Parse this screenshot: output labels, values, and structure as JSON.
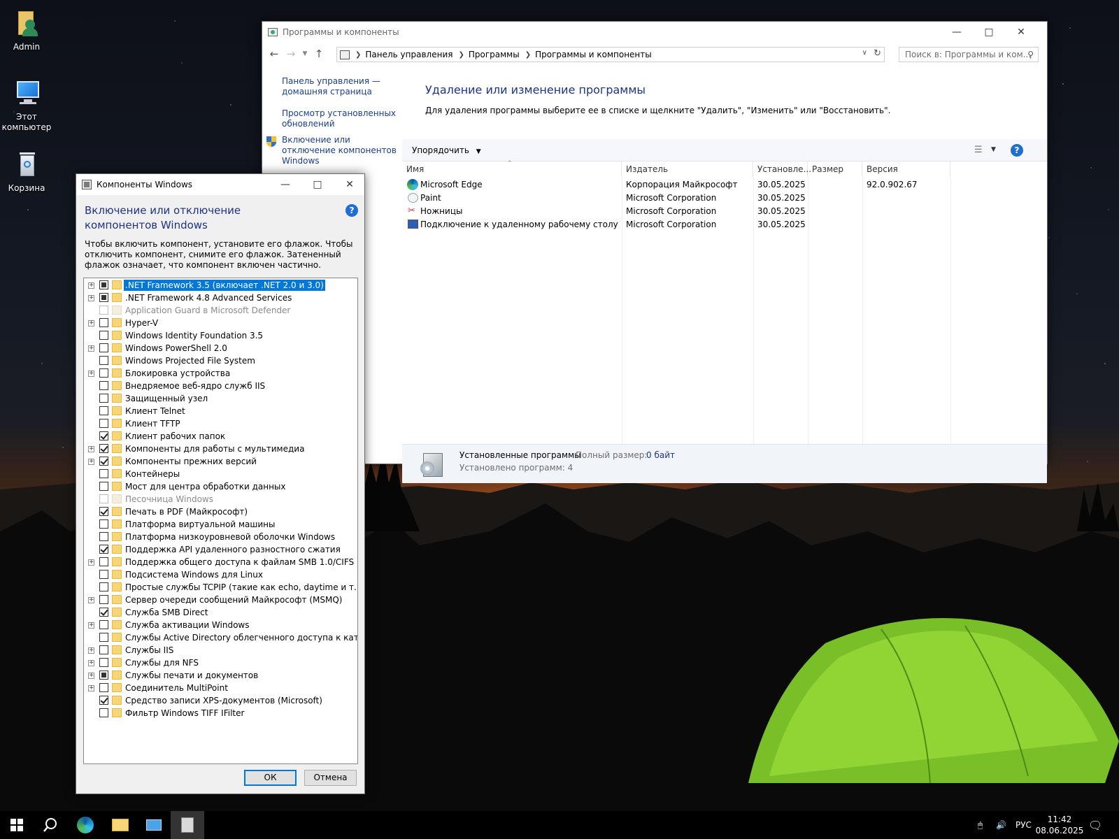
{
  "desktop": {
    "icons": [
      {
        "label": "Admin",
        "icon": "user-folder-icon"
      },
      {
        "label": "Этот компьютер",
        "icon": "computer-icon"
      },
      {
        "label": "Корзина",
        "icon": "recycle-bin-icon"
      }
    ]
  },
  "programs_window": {
    "title": "Программы и компоненты",
    "breadcrumb": [
      "Панель управления",
      "Программы",
      "Программы и компоненты"
    ],
    "search_placeholder": "Поиск в: Программы и ком...",
    "left_links": [
      "Панель управления — домашняя страница",
      "Просмотр установленных обновлений",
      "Включение или отключение компонентов Windows"
    ],
    "heading": "Удаление или изменение программы",
    "description": "Для удаления программы выберите ее в списке и щелкните \"Удалить\", \"Изменить\" или \"Восстановить\".",
    "organize_label": "Упорядочить",
    "columns": [
      "Имя",
      "Издатель",
      "Установле...",
      "Размер",
      "Версия"
    ],
    "rows": [
      {
        "name": "Microsoft Edge",
        "publisher": "Корпорация Майкрософт",
        "installed": "30.05.2025",
        "size": "",
        "version": "92.0.902.67",
        "icon": "edge-icon"
      },
      {
        "name": "Paint",
        "publisher": "Microsoft Corporation",
        "installed": "30.05.2025",
        "size": "",
        "version": "",
        "icon": "paint-icon"
      },
      {
        "name": "Ножницы",
        "publisher": "Microsoft Corporation",
        "installed": "30.05.2025",
        "size": "",
        "version": "",
        "icon": "snipping-tool-icon"
      },
      {
        "name": "Подключение к удаленному рабочему столу",
        "publisher": "Microsoft Corporation",
        "installed": "30.05.2025",
        "size": "",
        "version": "",
        "icon": "remote-desktop-icon"
      }
    ],
    "status": {
      "title": "Установленные программы",
      "total_size_label": "Полный размер:",
      "total_size_value": "0 байт",
      "count_text": "Установлено программ: 4"
    }
  },
  "components_window": {
    "title": "Компоненты Windows",
    "heading": "Включение или отключение компонентов Windows",
    "description": "Чтобы включить компонент, установите его флажок. Чтобы отключить компонент, снимите его флажок. Затененный флажок означает, что компонент включен частично.",
    "items": [
      {
        "label": ".NET Framework 3.5 (включает .NET 2.0 и 3.0)",
        "state": "partial",
        "expandable": true,
        "selected": true,
        "disabled": false
      },
      {
        "label": ".NET Framework 4.8 Advanced Services",
        "state": "partial",
        "expandable": true,
        "selected": false,
        "disabled": false
      },
      {
        "label": "Application Guard в Microsoft Defender",
        "state": "unchecked",
        "expandable": false,
        "selected": false,
        "disabled": true
      },
      {
        "label": "Hyper-V",
        "state": "unchecked",
        "expandable": true,
        "selected": false,
        "disabled": false
      },
      {
        "label": "Windows Identity Foundation 3.5",
        "state": "unchecked",
        "expandable": false,
        "selected": false,
        "disabled": false
      },
      {
        "label": "Windows PowerShell 2.0",
        "state": "unchecked",
        "expandable": true,
        "selected": false,
        "disabled": false
      },
      {
        "label": "Windows Projected File System",
        "state": "unchecked",
        "expandable": false,
        "selected": false,
        "disabled": false
      },
      {
        "label": "Блокировка устройства",
        "state": "unchecked",
        "expandable": true,
        "selected": false,
        "disabled": false
      },
      {
        "label": "Внедряемое веб-ядро служб IIS",
        "state": "unchecked",
        "expandable": false,
        "selected": false,
        "disabled": false
      },
      {
        "label": "Защищенный узел",
        "state": "unchecked",
        "expandable": false,
        "selected": false,
        "disabled": false
      },
      {
        "label": "Клиент Telnet",
        "state": "unchecked",
        "expandable": false,
        "selected": false,
        "disabled": false
      },
      {
        "label": "Клиент TFTP",
        "state": "unchecked",
        "expandable": false,
        "selected": false,
        "disabled": false
      },
      {
        "label": "Клиент рабочих папок",
        "state": "checked",
        "expandable": false,
        "selected": false,
        "disabled": false
      },
      {
        "label": "Компоненты для работы с мультимедиа",
        "state": "checked",
        "expandable": true,
        "selected": false,
        "disabled": false
      },
      {
        "label": "Компоненты прежних версий",
        "state": "checked",
        "expandable": true,
        "selected": false,
        "disabled": false
      },
      {
        "label": "Контейнеры",
        "state": "unchecked",
        "expandable": false,
        "selected": false,
        "disabled": false
      },
      {
        "label": "Мост для центра обработки данных",
        "state": "unchecked",
        "expandable": false,
        "selected": false,
        "disabled": false
      },
      {
        "label": "Песочница Windows",
        "state": "unchecked",
        "expandable": false,
        "selected": false,
        "disabled": true
      },
      {
        "label": "Печать в PDF (Майкрософт)",
        "state": "checked",
        "expandable": false,
        "selected": false,
        "disabled": false
      },
      {
        "label": "Платформа виртуальной машины",
        "state": "unchecked",
        "expandable": false,
        "selected": false,
        "disabled": false
      },
      {
        "label": "Платформа низкоуровневой оболочки Windows",
        "state": "unchecked",
        "expandable": false,
        "selected": false,
        "disabled": false
      },
      {
        "label": "Поддержка API удаленного разностного сжатия",
        "state": "checked",
        "expandable": false,
        "selected": false,
        "disabled": false
      },
      {
        "label": "Поддержка общего доступа к файлам SMB 1.0/CIFS",
        "state": "unchecked",
        "expandable": true,
        "selected": false,
        "disabled": false
      },
      {
        "label": "Подсистема Windows для Linux",
        "state": "unchecked",
        "expandable": false,
        "selected": false,
        "disabled": false
      },
      {
        "label": "Простые службы TCPIP (такие как echo, daytime и т.п.)",
        "state": "unchecked",
        "expandable": false,
        "selected": false,
        "disabled": false
      },
      {
        "label": "Сервер очереди сообщений Майкрософт (MSMQ)",
        "state": "unchecked",
        "expandable": true,
        "selected": false,
        "disabled": false
      },
      {
        "label": "Служба SMB Direct",
        "state": "checked",
        "expandable": false,
        "selected": false,
        "disabled": false
      },
      {
        "label": "Служба активации Windows",
        "state": "unchecked",
        "expandable": true,
        "selected": false,
        "disabled": false
      },
      {
        "label": "Службы Active Directory облегченного доступа к каталогам",
        "state": "unchecked",
        "expandable": false,
        "selected": false,
        "disabled": false
      },
      {
        "label": "Службы IIS",
        "state": "unchecked",
        "expandable": true,
        "selected": false,
        "disabled": false
      },
      {
        "label": "Службы для NFS",
        "state": "unchecked",
        "expandable": true,
        "selected": false,
        "disabled": false
      },
      {
        "label": "Службы печати и документов",
        "state": "partial",
        "expandable": true,
        "selected": false,
        "disabled": false
      },
      {
        "label": "Соединитель MultiPoint",
        "state": "unchecked",
        "expandable": true,
        "selected": false,
        "disabled": false
      },
      {
        "label": "Средство записи XPS-документов (Microsoft)",
        "state": "checked",
        "expandable": false,
        "selected": false,
        "disabled": false
      },
      {
        "label": "Фильтр Windows TIFF IFilter",
        "state": "unchecked",
        "expandable": false,
        "selected": false,
        "disabled": false
      }
    ],
    "ok_label": "ОК",
    "cancel_label": "Отмена"
  },
  "taskbar": {
    "language": "РУС",
    "time": "11:42",
    "date": "08.06.2025"
  },
  "colors": {
    "accent": "#0078d7",
    "link": "#1a3e8c",
    "heading": "#1e3287"
  }
}
